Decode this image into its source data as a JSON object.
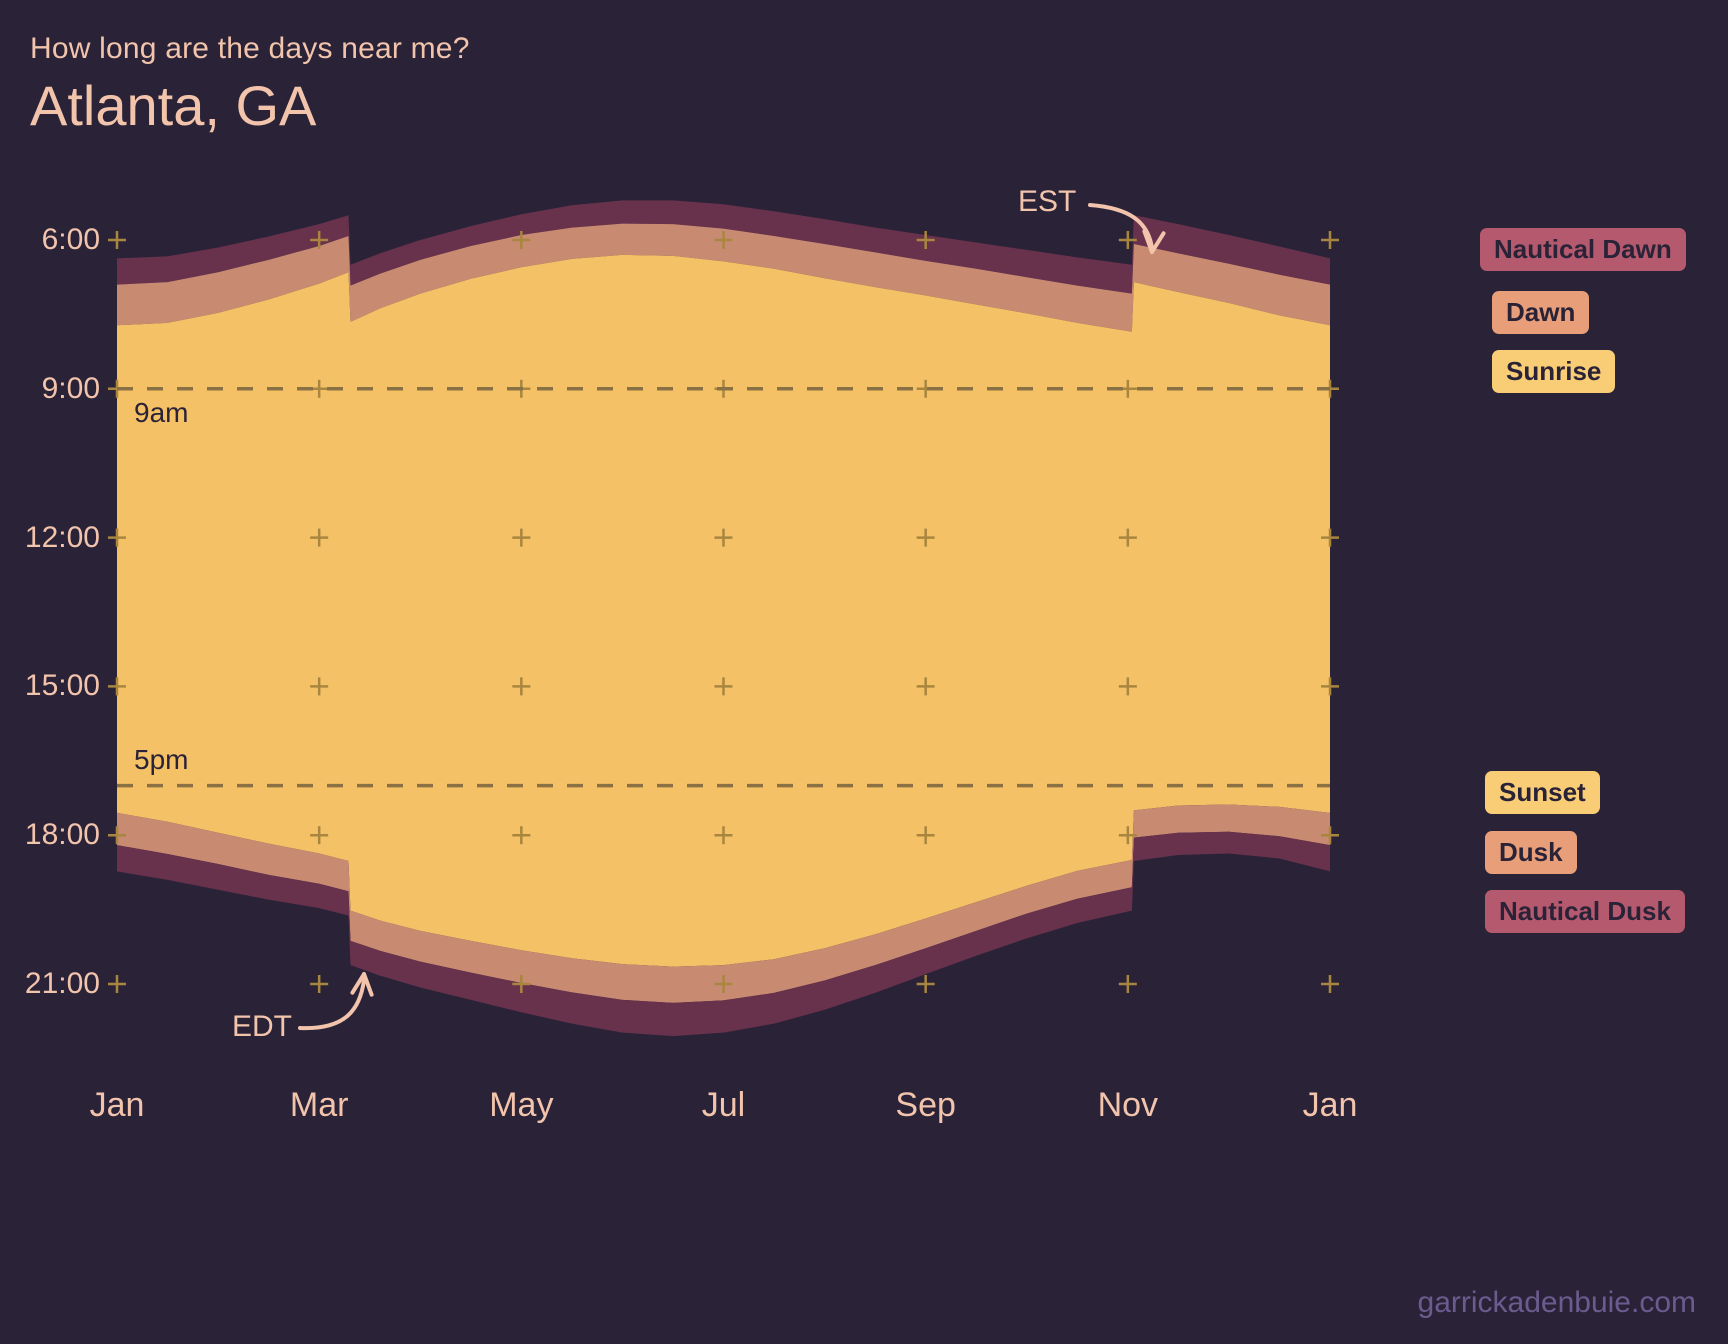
{
  "header": {
    "subtitle": "How long are the days near me?",
    "title": "Atlanta, GA"
  },
  "watermark": "garrickadenbuie.com",
  "colors": {
    "background": "#2a2338",
    "text": "#f3c4ac",
    "daylight": "#f5c166",
    "civil": "#c98a72",
    "nautical": "#68314c",
    "nautical_dawn_badge": "#b5596e",
    "dawn_badge": "#e79e79",
    "sunrise_badge": "#f9cd76",
    "sunset_badge": "#f9cd76",
    "dusk_badge": "#e79e79",
    "nautical_dusk_badge": "#b5596e",
    "tick_mark": "#a8863f",
    "reference_line": "#8a7144",
    "watermark": "#6b5b8e"
  },
  "annotations": {
    "nine_am": "9am",
    "five_pm": "5pm",
    "est": "EST",
    "edt": "EDT"
  },
  "legend": {
    "top": [
      {
        "label": "Nautical Dawn",
        "color": "#b5596e"
      },
      {
        "label": "Dawn",
        "color": "#e79e79"
      },
      {
        "label": "Sunrise",
        "color": "#f9cd76"
      }
    ],
    "bottom": [
      {
        "label": "Sunset",
        "color": "#f9cd76"
      },
      {
        "label": "Dusk",
        "color": "#e79e79"
      },
      {
        "label": "Nautical Dusk",
        "color": "#b5596e"
      }
    ]
  },
  "chart_data": {
    "type": "area",
    "title": "Atlanta, GA",
    "subtitle": "How long are the days near me?",
    "xlabel": "",
    "ylabel": "",
    "grid": false,
    "legend_position": "right",
    "y_axis": {
      "tick_labels": [
        "6:00",
        "9:00",
        "12:00",
        "15:00",
        "18:00",
        "21:00"
      ],
      "tick_hours": [
        6,
        9,
        12,
        15,
        18,
        21
      ],
      "range_hours": [
        5.0,
        22.0
      ],
      "inverted": true
    },
    "x_axis": {
      "tick_labels": [
        "Jan",
        "Mar",
        "May",
        "Jul",
        "Sep",
        "Nov",
        "Jan"
      ],
      "tick_months": [
        1,
        3,
        5,
        7,
        9,
        11,
        13
      ]
    },
    "reference_lines": [
      {
        "label": "9am",
        "hour": 9.0,
        "style": "dashed"
      },
      {
        "label": "5pm",
        "hour": 17.0,
        "style": "dashed"
      }
    ],
    "dst_transitions": [
      {
        "label": "EDT",
        "month": 3.3,
        "direction": "spring-forward"
      },
      {
        "label": "EST",
        "month": 11.05,
        "direction": "fall-back"
      }
    ],
    "x_points_months": [
      1.0,
      1.5,
      2.0,
      2.5,
      3.0,
      3.29,
      3.31,
      3.6,
      4.0,
      4.5,
      5.0,
      5.5,
      6.0,
      6.5,
      7.0,
      7.5,
      8.0,
      8.5,
      9.0,
      9.5,
      10.0,
      10.5,
      11.04,
      11.06,
      11.5,
      12.0,
      12.5,
      13.0
    ],
    "series": [
      {
        "name": "Nautical Dawn",
        "color": "#68314c",
        "values_hours": [
          6.37,
          6.33,
          6.15,
          5.93,
          5.68,
          5.5,
          6.5,
          6.27,
          6.0,
          5.72,
          5.48,
          5.3,
          5.2,
          5.2,
          5.28,
          5.42,
          5.58,
          5.75,
          5.9,
          6.05,
          6.2,
          6.35,
          6.5,
          5.5,
          5.68,
          5.9,
          6.13,
          6.37
        ]
      },
      {
        "name": "Dawn",
        "color": "#c98a72",
        "values_hours": [
          6.9,
          6.85,
          6.65,
          6.4,
          6.12,
          5.92,
          6.92,
          6.68,
          6.4,
          6.12,
          5.9,
          5.75,
          5.67,
          5.68,
          5.77,
          5.92,
          6.08,
          6.25,
          6.42,
          6.58,
          6.75,
          6.92,
          7.08,
          6.08,
          6.27,
          6.48,
          6.7,
          6.9
        ]
      },
      {
        "name": "Sunrise",
        "color": "#f5c166",
        "values_hours": [
          7.72,
          7.67,
          7.47,
          7.2,
          6.88,
          6.65,
          7.65,
          7.38,
          7.08,
          6.78,
          6.55,
          6.38,
          6.3,
          6.32,
          6.43,
          6.58,
          6.77,
          6.95,
          7.12,
          7.3,
          7.48,
          7.67,
          7.85,
          6.85,
          7.05,
          7.27,
          7.52,
          7.72
        ]
      },
      {
        "name": "Sunset",
        "color": "#f5c166",
        "values_hours": [
          17.55,
          17.73,
          17.95,
          18.17,
          18.37,
          18.52,
          19.52,
          19.72,
          19.93,
          20.13,
          20.32,
          20.48,
          20.6,
          20.65,
          20.62,
          20.5,
          20.28,
          20.0,
          19.68,
          19.35,
          19.02,
          18.72,
          18.5,
          17.5,
          17.4,
          17.38,
          17.43,
          17.55
        ]
      },
      {
        "name": "Dusk",
        "color": "#c98a72",
        "values_hours": [
          18.2,
          18.38,
          18.58,
          18.8,
          18.98,
          19.13,
          20.13,
          20.33,
          20.55,
          20.77,
          20.98,
          21.17,
          21.32,
          21.38,
          21.33,
          21.18,
          20.93,
          20.62,
          20.28,
          19.93,
          19.58,
          19.28,
          19.05,
          18.05,
          17.95,
          17.93,
          18.02,
          18.2
        ]
      },
      {
        "name": "Nautical Dusk",
        "color": "#68314c",
        "values_hours": [
          18.73,
          18.9,
          19.1,
          19.3,
          19.47,
          19.62,
          20.62,
          20.83,
          21.07,
          21.32,
          21.57,
          21.8,
          21.98,
          22.05,
          21.98,
          21.8,
          21.52,
          21.18,
          20.8,
          20.43,
          20.08,
          19.77,
          19.52,
          18.52,
          18.4,
          18.37,
          18.47,
          18.73
        ]
      }
    ]
  }
}
